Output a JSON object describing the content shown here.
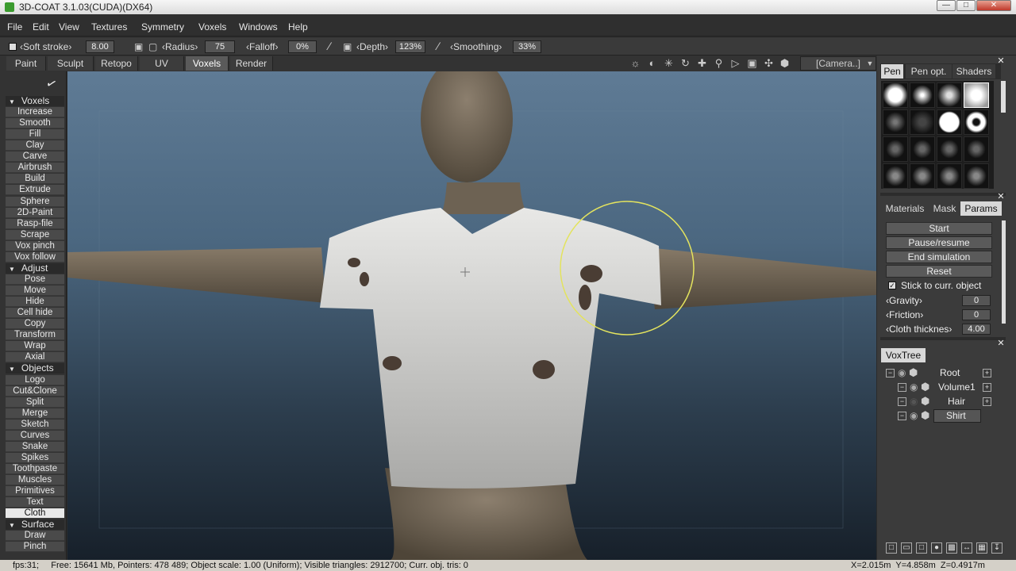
{
  "window": {
    "title": "3D-COAT 3.1.03(CUDA)(DX64)"
  },
  "menu": [
    "File",
    "Edit",
    "View",
    "Textures",
    "Symmetry",
    "Voxels",
    "Windows",
    "Help"
  ],
  "toolbar": {
    "soft_stroke_label": "‹Soft stroke›",
    "soft_stroke_value": "8.00",
    "radius_label": "‹Radius›",
    "radius_value": "75",
    "falloff_label": "‹Falloff›",
    "falloff_value": "0%",
    "depth_label": "‹Depth›",
    "depth_value": "123%",
    "smoothing_label": "‹Smoothing›",
    "smoothing_value": "33%"
  },
  "rooms": [
    "Paint",
    "Sculpt",
    "Retopo",
    "UV",
    "Voxels",
    "Render"
  ],
  "active_room": "Voxels",
  "camera_select": "[Camera..]",
  "tool_groups": {
    "voxels": {
      "title": "Voxels",
      "items": [
        "Increase",
        "Smooth",
        "Fill",
        "Clay",
        "Carve",
        "Airbrush",
        "Build",
        "Extrude",
        "Sphere",
        "2D-Paint",
        "Rasp-file",
        "Scrape",
        "Vox pinch",
        "Vox follow"
      ]
    },
    "adjust": {
      "title": "Adjust",
      "items": [
        "Pose",
        "Move",
        "Hide",
        "Cell hide",
        "Copy",
        "Transform",
        "Wrap",
        "Axial"
      ]
    },
    "objects": {
      "title": "Objects",
      "items": [
        "Logo",
        "Cut&Clone",
        "Split",
        "Merge",
        "Sketch",
        "Curves",
        "Snake",
        "Spikes",
        "Toothpaste",
        "Muscles",
        "Primitives",
        "Text",
        "Cloth"
      ]
    },
    "surface": {
      "title": "Surface",
      "items": [
        "Draw",
        "Pinch"
      ]
    }
  },
  "selected_tool": "Cloth",
  "pen_panel": {
    "tabs": [
      "Pen",
      "Pen opt.",
      "Shaders"
    ]
  },
  "params_panel": {
    "tabs": [
      "Materials",
      "Mask",
      "Params"
    ],
    "buttons": [
      "Start",
      "Pause/resume",
      "End simulation",
      "Reset"
    ],
    "checkbox_label": "Stick to curr. object",
    "checkbox_checked": true,
    "gravity_label": "‹Gravity›",
    "gravity_value": "0",
    "friction_label": "‹Friction›",
    "friction_value": "0",
    "thickness_label": "‹Cloth thicknes›",
    "thickness_value": "4.00"
  },
  "voxtree": {
    "title": "VoxTree",
    "items": [
      "Root",
      "Volume1",
      "Hair",
      "Shirt"
    ],
    "selected": "Shirt"
  },
  "status": {
    "left": "fps:31;     Free: 15641 Mb, Pointers: 478 489; Object scale: 1.00 (Uniform); Visible triangles: 2912700; Curr. obj. tris: 0",
    "right": "X=2.015m  Y=4.858m  Z=0.4917m"
  }
}
